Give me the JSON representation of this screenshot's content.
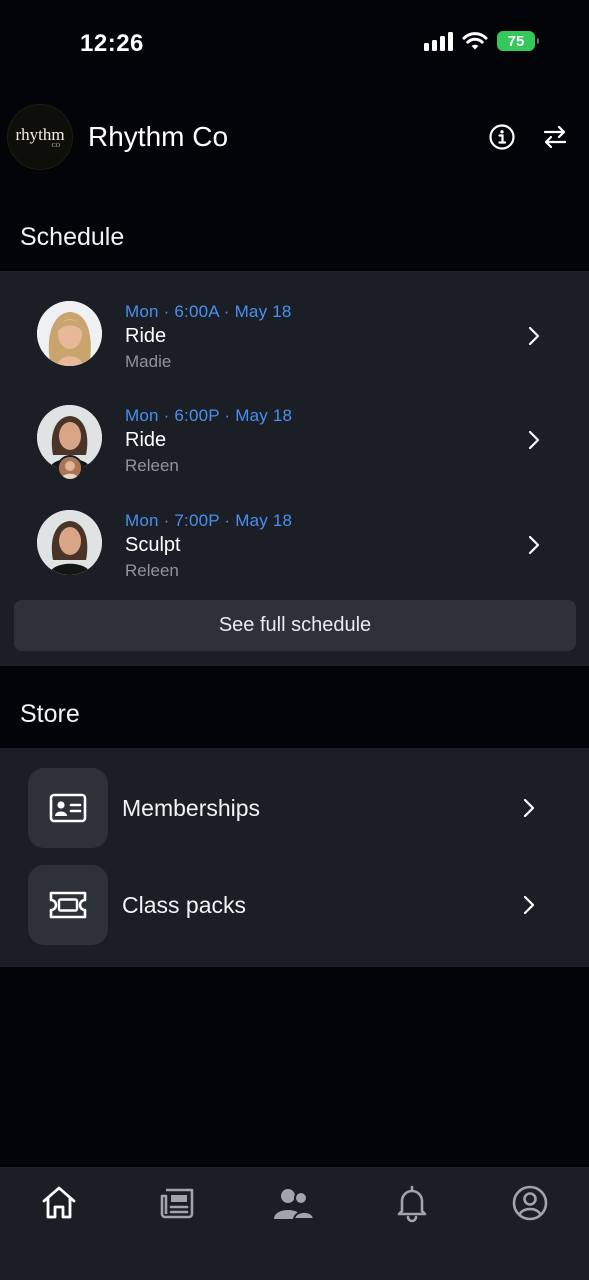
{
  "status_bar": {
    "time": "12:26",
    "battery": "75"
  },
  "header": {
    "logo_text": "rhythm",
    "logo_sub": "CO",
    "title": "Rhythm Co"
  },
  "schedule": {
    "title": "Schedule",
    "classes": [
      {
        "meta": "Mon · 6:00A · May 18",
        "name": "Ride",
        "instructor": "Madie"
      },
      {
        "meta": "Mon · 6:00P · May 18",
        "name": "Ride",
        "instructor": "Releen"
      },
      {
        "meta": "Mon · 7:00P · May 18",
        "name": "Sculpt",
        "instructor": "Releen"
      }
    ],
    "see_full": "See full schedule"
  },
  "store": {
    "title": "Store",
    "items": [
      {
        "label": "Memberships",
        "icon": "id-card-icon"
      },
      {
        "label": "Class packs",
        "icon": "ticket-icon"
      }
    ]
  },
  "tabs": [
    {
      "icon": "home-icon"
    },
    {
      "icon": "news-icon"
    },
    {
      "icon": "community-icon"
    },
    {
      "icon": "bell-icon"
    },
    {
      "icon": "profile-icon"
    }
  ],
  "colors": {
    "accent": "#4a8ff0",
    "card": "#1b1e24",
    "background": "#030407",
    "battery": "#34c759"
  }
}
